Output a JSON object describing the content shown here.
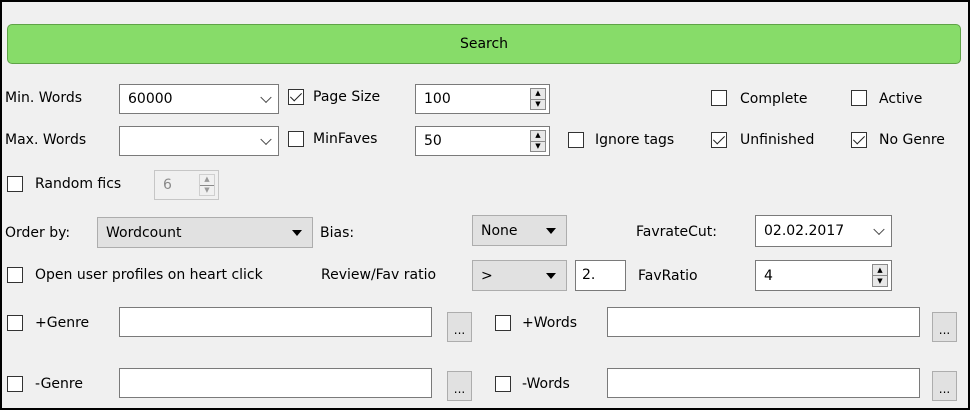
{
  "search_button": "Search",
  "min_words": {
    "label": "Min. Words",
    "value": "60000"
  },
  "max_words": {
    "label": "Max. Words",
    "value": ""
  },
  "page_size": {
    "label": "Page Size",
    "checked": true,
    "value": "100"
  },
  "min_faves": {
    "label": "MinFaves",
    "checked": false,
    "value": "50"
  },
  "complete": {
    "label": "Complete",
    "checked": false
  },
  "active": {
    "label": "Active",
    "checked": false
  },
  "ignore_tags": {
    "label": "Ignore tags",
    "checked": false
  },
  "unfinished": {
    "label": "Unfinished",
    "checked": true
  },
  "no_genre": {
    "label": "No Genre",
    "checked": true
  },
  "random_fics": {
    "label": "Random fics",
    "checked": false,
    "value": "6"
  },
  "order_by": {
    "label": "Order by:",
    "value": "Wordcount"
  },
  "bias": {
    "label": "Bias:",
    "value": "None"
  },
  "favrate_cut": {
    "label": "FavrateCut:",
    "value": "02.02.2017"
  },
  "open_profiles": {
    "label": "Open user profiles on heart click",
    "checked": false
  },
  "review_fav_ratio": {
    "label": "Review/Fav ratio",
    "operator": ">",
    "value": "2."
  },
  "fav_ratio": {
    "label": "FavRatio",
    "value": "4"
  },
  "plus_genre": {
    "label": "+Genre",
    "checked": false,
    "value": "",
    "browse": "..."
  },
  "plus_words": {
    "label": "+Words",
    "checked": false,
    "value": "",
    "browse": "..."
  },
  "minus_genre": {
    "label": "-Genre",
    "checked": false,
    "value": "",
    "browse": "..."
  },
  "minus_words": {
    "label": "-Words",
    "checked": false,
    "value": "",
    "browse": "..."
  }
}
